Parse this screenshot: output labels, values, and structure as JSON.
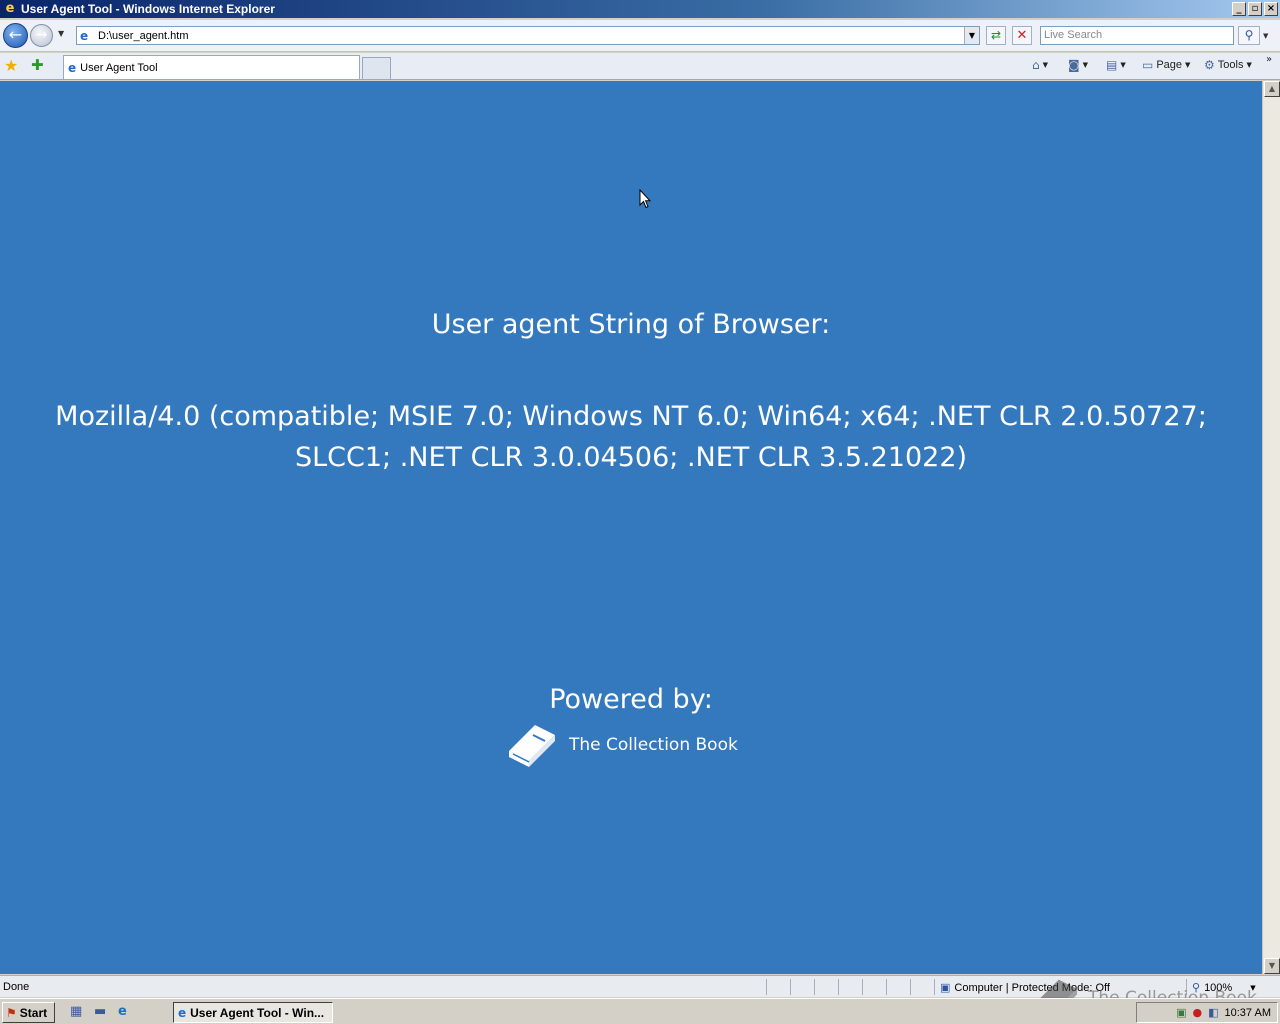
{
  "window": {
    "title": "User Agent Tool - Windows Internet Explorer",
    "minimize": "_",
    "maximize": "▫",
    "close": "×"
  },
  "nav": {
    "address": "D:\\user_agent.htm",
    "search_placeholder": "Live Search"
  },
  "tabs": [
    {
      "label": "User Agent Tool"
    }
  ],
  "commands": {
    "page": "Page",
    "tools": "Tools"
  },
  "content": {
    "heading": "User agent String of Browser:",
    "user_agent": "Mozilla/4.0 (compatible; MSIE 7.0; Windows NT 6.0; Win64; x64; .NET CLR 2.0.50727; SLCC1; .NET CLR 3.0.04506; .NET CLR 3.5.21022)",
    "powered_by": "Powered by:",
    "brand": "The Collection Book",
    "background_color": "#3478be"
  },
  "status": {
    "text": "Done",
    "zone": "Computer | Protected Mode: Off",
    "zoom": "100%"
  },
  "taskbar": {
    "start": "Start",
    "task": "User Agent Tool - Win...",
    "clock": "10:37 AM"
  },
  "watermark": {
    "text": "The Collection Book"
  },
  "icons": {
    "back": "back-arrow-icon",
    "forward": "forward-arrow-icon",
    "refresh": "refresh-icon",
    "stop": "stop-icon",
    "search": "magnifier-icon",
    "favorites": "star-icon",
    "add_favorites": "add-favorite-icon",
    "home": "home-icon",
    "feeds": "rss-icon",
    "print": "printer-icon",
    "page": "page-icon",
    "tools": "gear-icon",
    "brand": "book-icon"
  }
}
